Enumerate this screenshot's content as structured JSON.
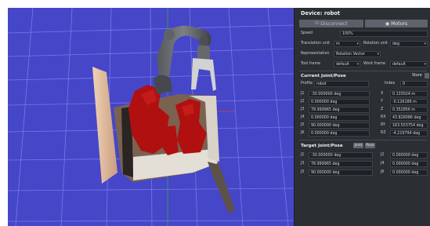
{
  "panel": {
    "device_title": "Device: robot",
    "disconnect_label": "Disconnect",
    "motors_label": "Motors",
    "speed_label": "Speed",
    "speed_value": "100%",
    "translation_unit_label": "Translation unit",
    "translation_unit_value": "m",
    "rotation_unit_label": "Rotation unit",
    "rotation_unit_value": "deg",
    "representation_label": "Representation",
    "representation_value": "Rotation Vector",
    "tool_frame_label": "Tool frame",
    "tool_frame_value": "default",
    "work_frame_label": "Work frame",
    "work_frame_value": "default",
    "current_section": "Current Joint/Pose",
    "store_label": "Store",
    "profile_label": "Profile",
    "profile_value": "robot",
    "index_label": "Index",
    "index_value": "0",
    "current_joints": [
      {
        "label": "J1",
        "value": "-30.000000 deg"
      },
      {
        "label": "J2",
        "value": "0.000000 deg"
      },
      {
        "label": "J3",
        "value": "78.999965 deg"
      },
      {
        "label": "J4",
        "value": "0.000000 deg"
      },
      {
        "label": "J5",
        "value": "90.000000 deg"
      },
      {
        "label": "J6",
        "value": "0.000000 deg"
      }
    ],
    "current_pose": [
      {
        "label": "X",
        "value": "0.133024 m"
      },
      {
        "label": "Y",
        "value": "-0.126186 m"
      },
      {
        "label": "Z",
        "value": "0.352856 m"
      },
      {
        "label": "RX",
        "value": "43.826086 deg"
      },
      {
        "label": "RY",
        "value": "163.553754 deg"
      },
      {
        "label": "RZ",
        "value": "-4.219794 deg"
      }
    ],
    "target_section": "Target Joint/Pose",
    "joint_button": "Joint",
    "pose_button": "Pose",
    "target_left": [
      {
        "label": "J1",
        "value": "-30.000000 deg"
      },
      {
        "label": "J3",
        "value": "78.999965 deg"
      },
      {
        "label": "J5",
        "value": "90.000000 deg"
      }
    ],
    "target_right": [
      {
        "label": "J2",
        "value": "0.000000 deg"
      },
      {
        "label": "J4",
        "value": "0.000000 deg"
      },
      {
        "label": "J6",
        "value": "0.000000 deg"
      }
    ]
  },
  "colors": {
    "viewport_bg": "#4646c8",
    "panel_bg": "#2b2f33",
    "object_red": "#b01010"
  }
}
